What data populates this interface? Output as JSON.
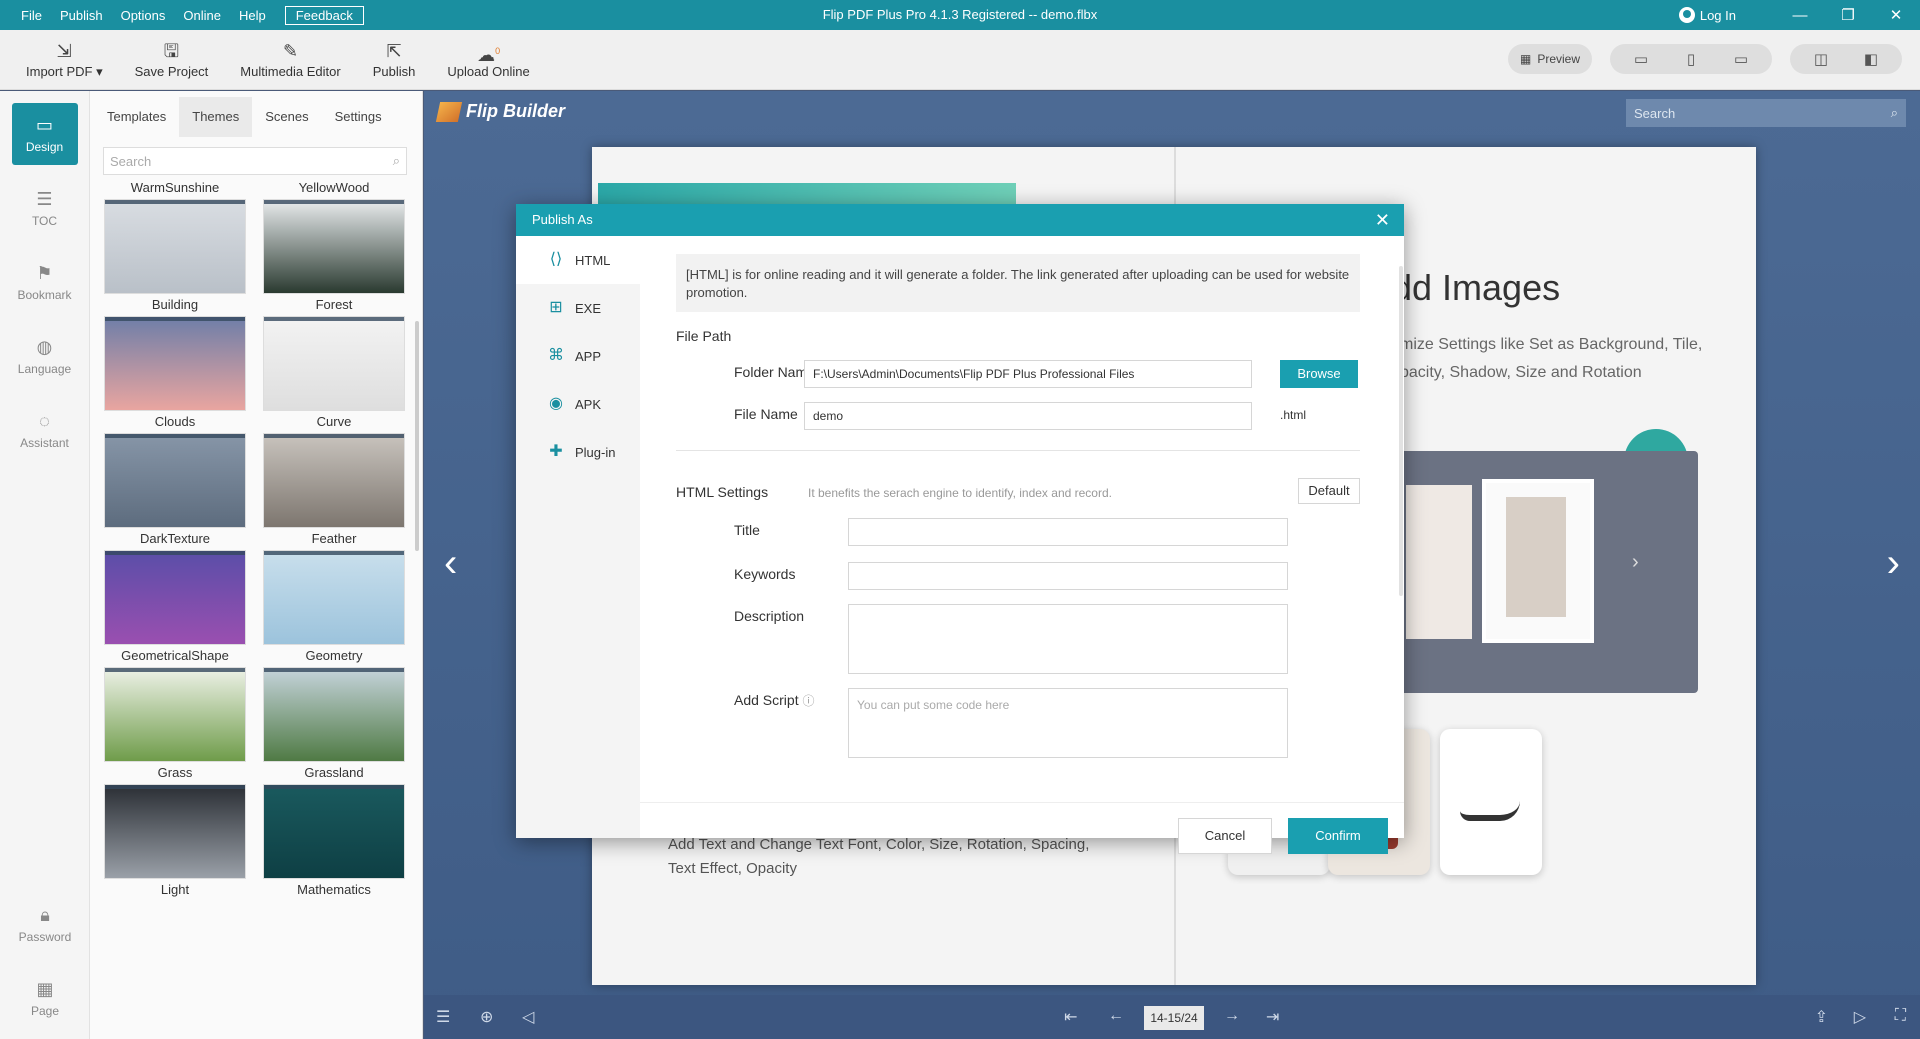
{
  "menu": {
    "items": [
      "File",
      "Publish",
      "Options",
      "Online",
      "Help"
    ],
    "feedback": "Feedback"
  },
  "window": {
    "title": "Flip PDF Plus Pro 4.1.3 Registered -- demo.flbx",
    "login": "Log In"
  },
  "toolbar": {
    "import_pdf": "Import PDF ▾",
    "save_project": "Save Project",
    "multimedia_editor": "Multimedia Editor",
    "publish": "Publish",
    "upload_online": "Upload Online",
    "upload_badge": "0",
    "preview": "Preview"
  },
  "rail": {
    "items": [
      "Design",
      "TOC",
      "Bookmark",
      "Language",
      "Assistant"
    ],
    "bottom": [
      "Password",
      "Page"
    ]
  },
  "panel": {
    "tabs": [
      "Templates",
      "Themes",
      "Scenes",
      "Settings"
    ],
    "search_placeholder": "Search",
    "themes": [
      {
        "name": "WarmSunshine",
        "colors": [
          "#c9d3db",
          "#8a98a8"
        ]
      },
      {
        "name": "YellowWood",
        "colors": [
          "#2f3a34",
          "#c3ccd0"
        ]
      },
      {
        "name": "Building",
        "colors": [
          "#d9dde2",
          "#b9c0c8"
        ]
      },
      {
        "name": "Forest",
        "colors": [
          "#e9ecee",
          "#2a3a30"
        ]
      },
      {
        "name": "Clouds",
        "colors": [
          "#6e7ea8",
          "#e9a5a0"
        ]
      },
      {
        "name": "Curve",
        "colors": [
          "#f3f3f3",
          "#dedede"
        ]
      },
      {
        "name": "DarkTexture",
        "colors": [
          "#8796a8",
          "#5d6c7e"
        ]
      },
      {
        "name": "Feather",
        "colors": [
          "#c9c4be",
          "#7d766f"
        ]
      },
      {
        "name": "GeometricalShape",
        "colors": [
          "#5a4ea8",
          "#9a4fb0"
        ]
      },
      {
        "name": "Geometry",
        "colors": [
          "#c9dfec",
          "#9cc3dc"
        ]
      },
      {
        "name": "Grass",
        "colors": [
          "#eef2e8",
          "#6f9c4a"
        ]
      },
      {
        "name": "Grassland",
        "colors": [
          "#c6d4dc",
          "#4f7a44"
        ]
      },
      {
        "name": "Light",
        "colors": [
          "#2a2e34",
          "#9aa0a8"
        ]
      },
      {
        "name": "Mathematics",
        "colors": [
          "#1a5a5e",
          "#0e3f44"
        ]
      }
    ]
  },
  "preview": {
    "brand": "Flip Builder",
    "search_placeholder": "Search",
    "page_indicator": "14-15/24",
    "right_title": "dd Images",
    "right_sub": "mize Settings like  Set as Background, Tile, pacity, Shadow, Size and Rotation",
    "left_copy": "Add Text and Change Text  Font, Color, Size, Rotation, Spacing, Text Effect, Opacity"
  },
  "dialog": {
    "title": "Publish As",
    "formats": [
      "HTML",
      "EXE",
      "APP",
      "APK",
      "Plug-in"
    ],
    "info": "[HTML] is for online reading and it will generate a folder. The link generated after uploading can be used for website promotion.",
    "file_path_label": "File Path",
    "folder_name_label": "Folder Name",
    "folder_name_value": "F:\\Users\\Admin\\Documents\\Flip PDF Plus Professional Files",
    "browse": "Browse",
    "file_name_label": "File Name",
    "file_name_value": "demo",
    "file_ext": ".html",
    "html_settings_label": "HTML Settings",
    "html_settings_hint": "It benefits the serach engine to identify, index and record.",
    "default_button": "Default",
    "title_label": "Title",
    "keywords_label": "Keywords",
    "description_label": "Description",
    "add_script_label": "Add Script",
    "add_script_placeholder": "You can put some code here",
    "cancel": "Cancel",
    "confirm": "Confirm"
  },
  "colors": {
    "accent": "#1a9fb0",
    "titlebar": "#1a8fa0",
    "preview_bg": "#4c6a94"
  }
}
